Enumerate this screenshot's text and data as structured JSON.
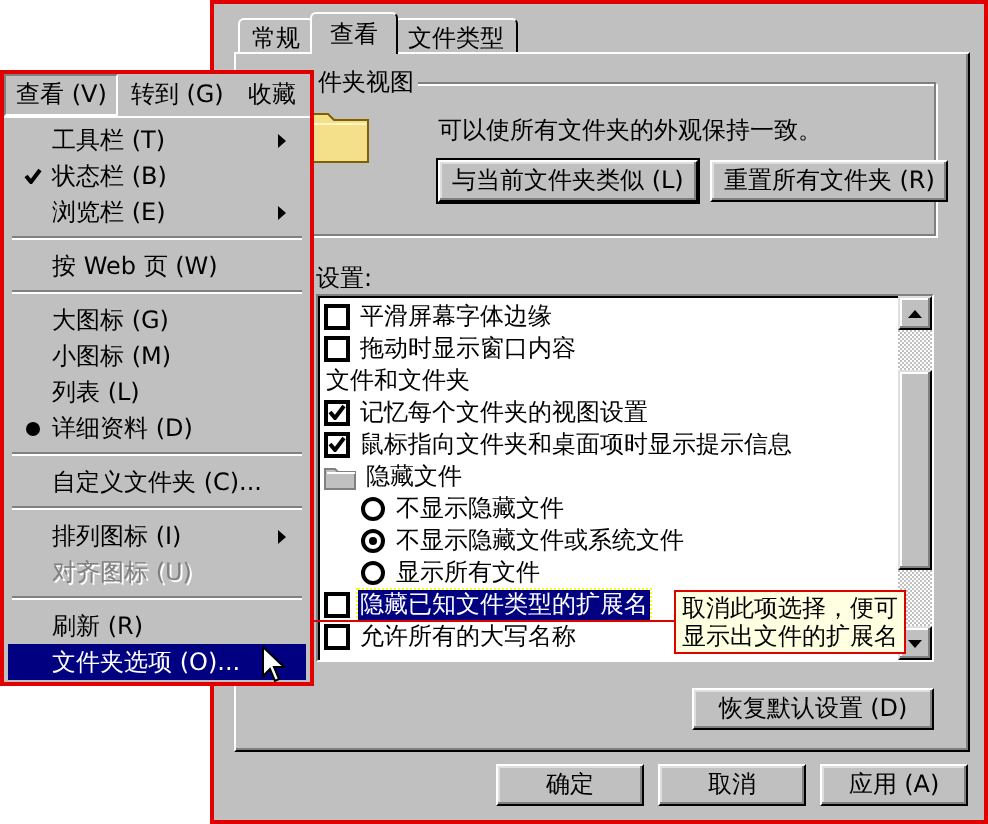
{
  "dialog": {
    "tabs": [
      {
        "label": "常规",
        "selected": false
      },
      {
        "label": "查看",
        "selected": true
      },
      {
        "label": "文件类型",
        "selected": false
      }
    ],
    "folder_views": {
      "title": "件夹视图",
      "description": "可以使所有文件夹的外观保持一致。",
      "buttons": [
        {
          "label": "与当前文件夹类似 (L)",
          "default": true
        },
        {
          "label": "重置所有文件夹 (R)",
          "default": false
        }
      ]
    },
    "settings_label": "设置:",
    "settings": [
      {
        "kind": "checkbox",
        "label": "平滑屏幕字体边缘",
        "checked": false,
        "selected": false
      },
      {
        "kind": "checkbox",
        "label": "拖动时显示窗口内容",
        "checked": false,
        "selected": false
      },
      {
        "kind": "heading",
        "label": "文件和文件夹",
        "selected": false
      },
      {
        "kind": "checkbox",
        "label": "记忆每个文件夹的视图设置",
        "checked": true,
        "selected": false
      },
      {
        "kind": "checkbox",
        "label": "鼠标指向文件夹和桌面项时显示提示信息",
        "checked": true,
        "selected": false
      },
      {
        "kind": "folder",
        "label": "隐藏文件",
        "selected": false,
        "children": [
          {
            "kind": "radio",
            "label": "不显示隐藏文件",
            "checked": false,
            "selected": false
          },
          {
            "kind": "radio",
            "label": "不显示隐藏文件或系统文件",
            "checked": true,
            "selected": false
          },
          {
            "kind": "radio",
            "label": "显示所有文件",
            "checked": false,
            "selected": false
          }
        ]
      },
      {
        "kind": "checkbox",
        "label": "隐藏已知文件类型的扩展名",
        "checked": false,
        "selected": true
      },
      {
        "kind": "checkbox",
        "label": "允许所有的大写名称",
        "checked": false,
        "selected": false
      }
    ],
    "tooltip": "取消此项选择，便可显示出文件的扩展名",
    "restore_button": "恢复默认设置 (D)",
    "buttons": [
      "确定",
      "取消",
      "应用 (A)"
    ]
  },
  "menubar": [
    {
      "label": "查看 (V)",
      "selected": true
    },
    {
      "label": "转到 (G)",
      "selected": false
    },
    {
      "label": "收藏",
      "selected": false
    }
  ],
  "menu": [
    {
      "kind": "item",
      "label": "工具栏 (T)",
      "checked": false,
      "submenu": true,
      "disabled": false,
      "selected": false
    },
    {
      "kind": "item",
      "label": "状态栏 (B)",
      "checked": true,
      "submenu": false,
      "disabled": false,
      "selected": false
    },
    {
      "kind": "item",
      "label": "浏览栏 (E)",
      "checked": false,
      "submenu": true,
      "disabled": false,
      "selected": false
    },
    {
      "kind": "separator"
    },
    {
      "kind": "item",
      "label": "按 Web 页 (W)",
      "checked": false,
      "submenu": false,
      "disabled": false,
      "selected": false
    },
    {
      "kind": "separator"
    },
    {
      "kind": "radio-item",
      "label": "大图标 (G)",
      "checked": false,
      "submenu": false,
      "disabled": false,
      "selected": false
    },
    {
      "kind": "radio-item",
      "label": "小图标 (M)",
      "checked": false,
      "submenu": false,
      "disabled": false,
      "selected": false
    },
    {
      "kind": "radio-item",
      "label": "列表 (L)",
      "checked": false,
      "submenu": false,
      "disabled": false,
      "selected": false
    },
    {
      "kind": "radio-item",
      "label": "详细资料 (D)",
      "checked": true,
      "submenu": false,
      "disabled": false,
      "selected": false
    },
    {
      "kind": "separator"
    },
    {
      "kind": "item",
      "label": "自定义文件夹 (C)...",
      "checked": false,
      "submenu": false,
      "disabled": false,
      "selected": false
    },
    {
      "kind": "separator"
    },
    {
      "kind": "item",
      "label": "排列图标 (I)",
      "checked": false,
      "submenu": true,
      "disabled": false,
      "selected": false
    },
    {
      "kind": "item",
      "label": "对齐图标 (U)",
      "checked": false,
      "submenu": false,
      "disabled": true,
      "selected": false
    },
    {
      "kind": "separator"
    },
    {
      "kind": "item",
      "label": "刷新 (R)",
      "checked": false,
      "submenu": false,
      "disabled": false,
      "selected": false
    },
    {
      "kind": "item",
      "label": "文件夹选项 (O)...",
      "checked": false,
      "submenu": false,
      "disabled": false,
      "selected": true
    }
  ]
}
